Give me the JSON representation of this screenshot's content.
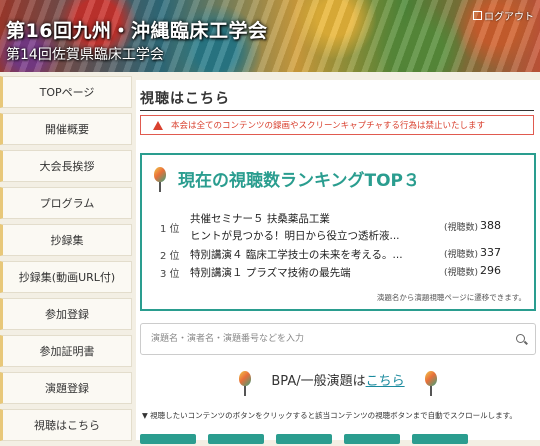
{
  "header": {
    "title": "第16回九州・沖縄臨床工学会",
    "subtitle": "第14回佐賀県臨床工学会",
    "logout_label": "ログアウト"
  },
  "sidebar": {
    "items": [
      {
        "label": "TOPページ"
      },
      {
        "label": "開催概要"
      },
      {
        "label": "大会長挨拶"
      },
      {
        "label": "プログラム"
      },
      {
        "label": "抄録集"
      },
      {
        "label": "抄録集(動画URL付)"
      },
      {
        "label": "参加登録"
      },
      {
        "label": "参加証明書"
      },
      {
        "label": "演題登録"
      },
      {
        "label": "視聴はこちら"
      }
    ]
  },
  "main": {
    "section_title": "視聴はこちら",
    "warning": "本会は全てのコンテンツの録画やスクリーンキャプチャする行為は禁止いたします",
    "ranking": {
      "title": "現在の視聴数ランキングTOP３",
      "count_label": "(視聴数)",
      "items": [
        {
          "rank": "1 位",
          "title_line1": "共催セミナー５ 扶桑薬品工業",
          "title_line2": "ヒントが見つかる！明日から役立つ透析液...",
          "count": "388"
        },
        {
          "rank": "2 位",
          "title_line1": "特別講演４ 臨床工学技士の未来を考える。...",
          "count": "337"
        },
        {
          "rank": "3 位",
          "title_line1": "特別講演１ プラズマ技術の最先端",
          "count": "296"
        }
      ],
      "note": "演題名から演題視聴ページに遷移できます。"
    },
    "search": {
      "placeholder": "演題名・演者名・演題番号などを入力"
    },
    "bpa": {
      "prefix": "BPA/一般演題は",
      "link": "こちら"
    },
    "instruction": "▼ 視聴したいコンテンツのボタンをクリックすると該当コンテンツの視聴ボタンまで自動でスクロールします。"
  },
  "colors": {
    "accent": "#2a9d8f",
    "warning": "#d9412f",
    "link": "#1a8a9e"
  }
}
